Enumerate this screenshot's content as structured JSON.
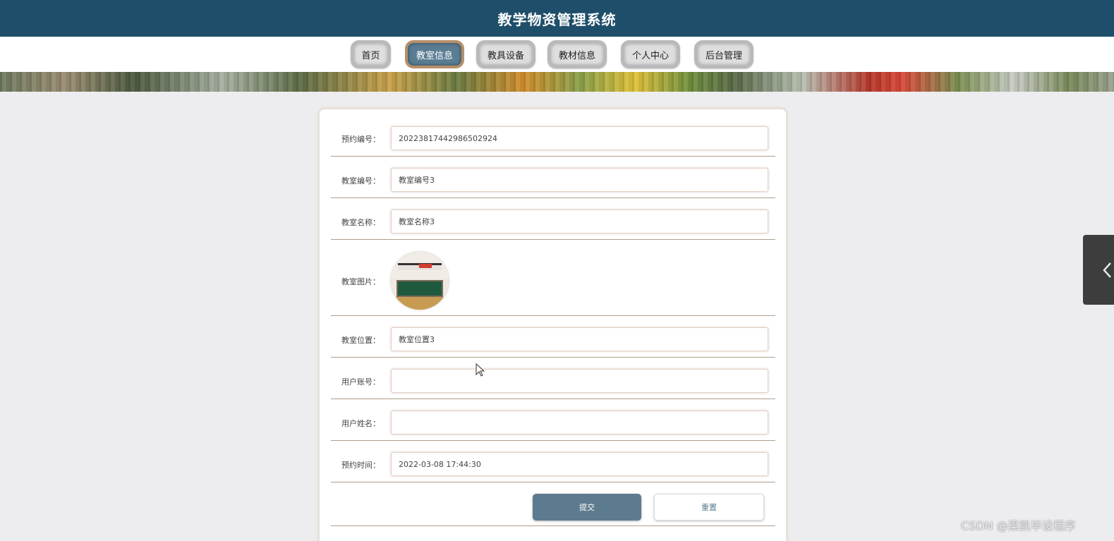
{
  "header": {
    "title": "教学物资管理系统"
  },
  "nav": {
    "items": [
      {
        "label": "首页",
        "active": false
      },
      {
        "label": "教室信息",
        "active": true
      },
      {
        "label": "教具设备",
        "active": false
      },
      {
        "label": "教材信息",
        "active": false
      },
      {
        "label": "个人中心",
        "active": false
      },
      {
        "label": "后台管理",
        "active": false
      }
    ]
  },
  "form": {
    "booking_no": {
      "label": "预约编号：",
      "value": "20223817442986502924"
    },
    "room_no": {
      "label": "教室编号：",
      "value": "教室编号3"
    },
    "room_name": {
      "label": "教室名称：",
      "value": "教室名称3"
    },
    "room_image": {
      "label": "教室图片："
    },
    "room_location": {
      "label": "教室位置：",
      "value": "教室位置3"
    },
    "user_account": {
      "label": "用户账号：",
      "value": ""
    },
    "user_name": {
      "label": "用户姓名：",
      "value": ""
    },
    "booking_time": {
      "label": "预约时间：",
      "value": "2022-03-08 17:44:30"
    },
    "submit_label": "提交",
    "reset_label": "重置"
  },
  "icons": {
    "side_tab": "chevron-left-icon",
    "cursor": "mouse-cursor-icon"
  },
  "colors": {
    "header_bg": "#1f4e6a",
    "active_nav": "#5a7d94",
    "submit_bg": "#5d7b8f"
  },
  "watermark": "CSDN @梁凯毕设程序"
}
